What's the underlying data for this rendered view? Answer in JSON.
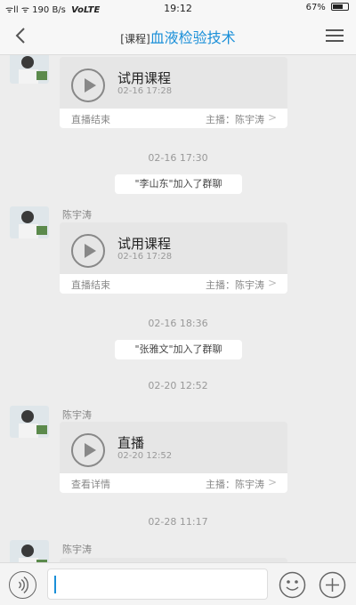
{
  "status_bar": {
    "signal": "ᯤll ᯤ 190 B/s",
    "network": "VoLTE",
    "time": "19:12",
    "battery": "67%"
  },
  "header": {
    "tag": "[课程]",
    "title": "血液检验技术"
  },
  "messages": [
    {
      "sender": "",
      "title": "试用课程",
      "time": "02-16 17:28",
      "status": "直播结束",
      "host": "主播：陈宇涛"
    },
    {
      "timestamp": "02-16 17:30"
    },
    {
      "system": "\"李山东\"加入了群聊"
    },
    {
      "sender": "陈宇涛",
      "title": "试用课程",
      "time": "02-16 17:28",
      "status": "直播结束",
      "host": "主播：陈宇涛"
    },
    {
      "timestamp": "02-16 18:36"
    },
    {
      "system": "\"张雅文\"加入了群聊"
    },
    {
      "timestamp": "02-20 12:52"
    },
    {
      "sender": "陈宇涛",
      "title": "直播",
      "time": "02-20 12:52",
      "status": "查看详情",
      "host": "主播：陈宇涛"
    },
    {
      "timestamp": "02-28 11:17"
    },
    {
      "sender": "陈宇涛"
    }
  ],
  "input": {
    "value": ""
  },
  "colors": {
    "accent": "#1a8fd8",
    "background": "#ededed"
  },
  "icons": {
    "back": "chevron-left-icon",
    "menu": "hamburger-menu-icon",
    "play": "play-circle-icon",
    "voice": "voice-icon",
    "emoji": "emoji-icon",
    "plus": "plus-circle-icon"
  }
}
